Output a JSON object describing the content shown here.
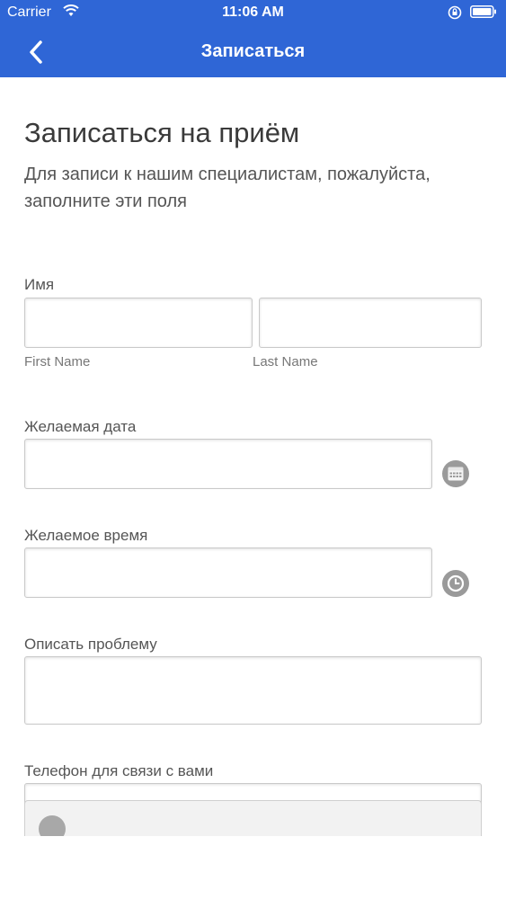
{
  "status_bar": {
    "carrier": "Carrier",
    "time": "11:06 AM"
  },
  "nav": {
    "title": "Записаться",
    "back_icon": "chevron-left-icon"
  },
  "form": {
    "title": "Записаться на приём",
    "subtitle": "Для записи к нашим специалистам, пожалуйста, заполните эти поля",
    "name": {
      "label": "Имя",
      "first_label": "First Name",
      "last_label": "Last Name",
      "first_value": "",
      "last_value": ""
    },
    "date": {
      "label": "Желаемая дата",
      "value": "",
      "icon": "calendar-icon"
    },
    "time": {
      "label": "Желаемое время",
      "value": "",
      "icon": "clock-icon"
    },
    "problem": {
      "label": "Описать проблему",
      "value": ""
    },
    "phone": {
      "label": "Телефон для связи с вами",
      "value": ""
    }
  },
  "colors": {
    "brand_blue": "#2f66d6",
    "icon_gray": "#9a9a9a"
  }
}
